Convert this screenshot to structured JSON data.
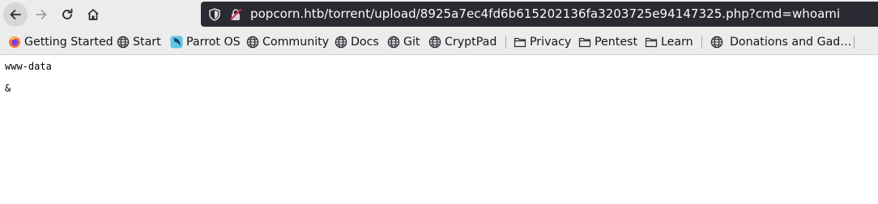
{
  "navigation": {
    "back_label": "Back",
    "forward_label": "Forward",
    "reload_label": "Reload",
    "home_label": "Home"
  },
  "address_bar": {
    "url": "popcorn.htb/torrent/upload/8925a7ec4fd6b615202136fa3203725e94147325.php?cmd=whoami",
    "icons": [
      "shield-icon",
      "insecure-lock-icon"
    ]
  },
  "bookmarks": {
    "items": [
      {
        "label": "Getting Started",
        "icon": "firefox-icon"
      },
      {
        "label": "Start",
        "icon": "globe-icon"
      },
      {
        "label": "Parrot OS",
        "icon": "parrot-icon"
      },
      {
        "label": "Community",
        "icon": "globe-icon"
      },
      {
        "label": "Docs",
        "icon": "globe-icon"
      },
      {
        "label": "Git",
        "icon": "globe-icon"
      },
      {
        "label": "CryptPad",
        "icon": "globe-icon"
      },
      {
        "label": "Privacy",
        "icon": "folder-icon"
      },
      {
        "label": "Pentest",
        "icon": "folder-icon"
      },
      {
        "label": "Learn",
        "icon": "folder-icon"
      },
      {
        "label": "Donations and Gad…",
        "icon": "globe-icon"
      }
    ]
  },
  "page": {
    "output_line_1": "www-data",
    "output_line_2": "&"
  },
  "colors": {
    "toolbar_bg": "#ececec",
    "urlbar_bg": "#2b2a33",
    "urlbar_text": "#fbfbfe",
    "insecure_red": "#e22850"
  }
}
